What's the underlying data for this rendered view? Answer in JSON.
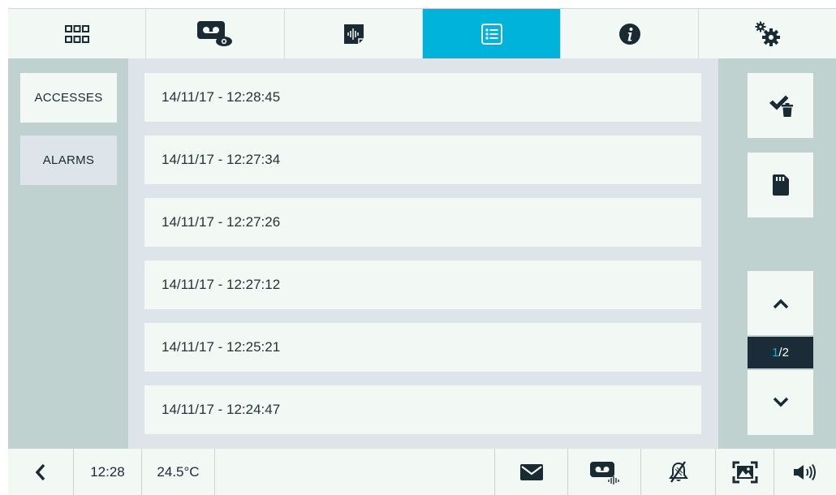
{
  "top_tabs": [
    {
      "icon": "apps-grid-icon"
    },
    {
      "icon": "voicemail-view-icon"
    },
    {
      "icon": "audio-message-icon"
    },
    {
      "icon": "event-list-icon",
      "active": true
    },
    {
      "icon": "info-icon"
    },
    {
      "icon": "settings-icon"
    }
  ],
  "sidebar": {
    "accesses_label": "ACCESSES",
    "alarms_label": "ALARMS"
  },
  "events": [
    "14/11/17 - 12:28:45",
    "14/11/17 - 12:27:34",
    "14/11/17 - 12:27:26",
    "14/11/17 - 12:27:12",
    "14/11/17 - 12:25:21",
    "14/11/17 - 12:24:47"
  ],
  "pagination": {
    "current": "1",
    "total": "/2"
  },
  "status_bar": {
    "time": "12:28",
    "temperature": "24.5°C"
  },
  "colors": {
    "accent": "#00b3da",
    "panel": "#bfd2cf",
    "list_background": "#dde4ea",
    "item_background": "#f2f8f4",
    "dark": "#1b2c38"
  }
}
